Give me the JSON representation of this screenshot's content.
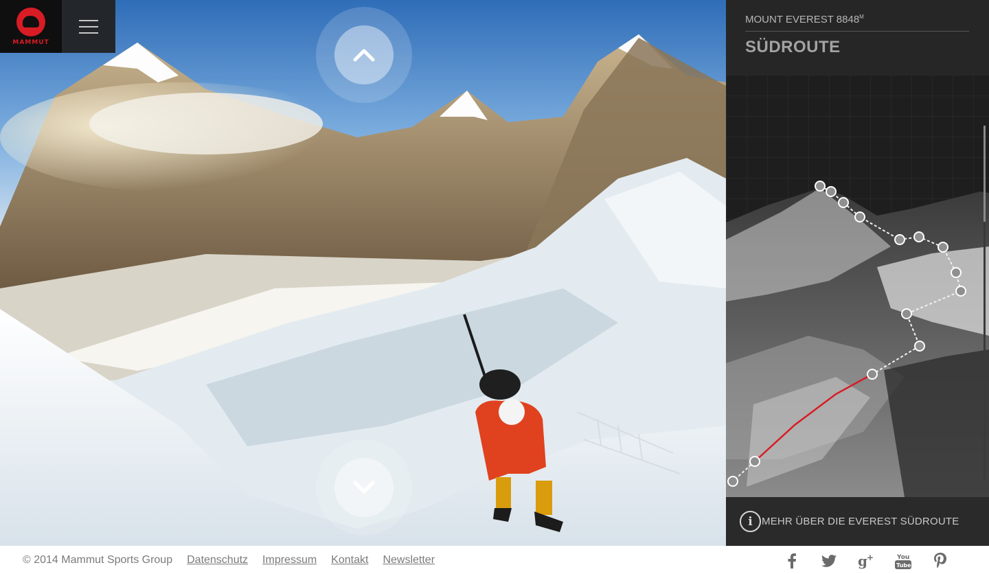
{
  "brand": {
    "wordmark": "MAMMUT"
  },
  "navigation": {
    "menu_icon": "hamburger-icon",
    "up_icon": "chevron-up-icon",
    "down_icon": "chevron-down-icon"
  },
  "panel": {
    "subtitle": "MOUNT EVEREST 8848",
    "subtitle_unit": "M",
    "title": "SÜDROUTE",
    "info_label": "MEHR ÜBER DIE EVEREST SÜDROUTE",
    "info_icon": "info-icon",
    "route_color": "#d81c25"
  },
  "footer": {
    "copyright": "© 2014 Mammut Sports Group",
    "links": [
      "Datenschutz",
      "Impressum",
      "Kontakt",
      "Newsletter"
    ],
    "social_icons": [
      "facebook-icon",
      "twitter-icon",
      "google-plus-icon",
      "youtube-icon",
      "pinterest-icon"
    ]
  },
  "colors": {
    "brand_red": "#d81c25",
    "panel_bg": "#1c1c1c"
  }
}
